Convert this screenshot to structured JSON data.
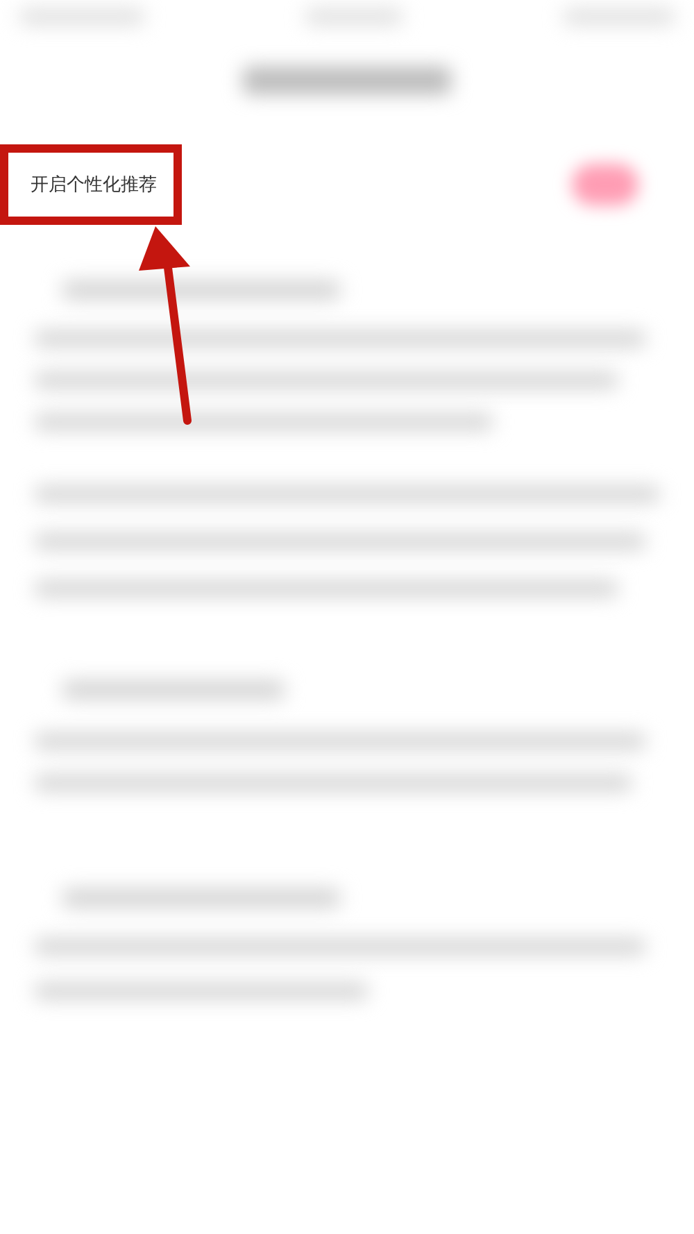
{
  "setting": {
    "label": "开启个性化推荐",
    "on": true
  }
}
